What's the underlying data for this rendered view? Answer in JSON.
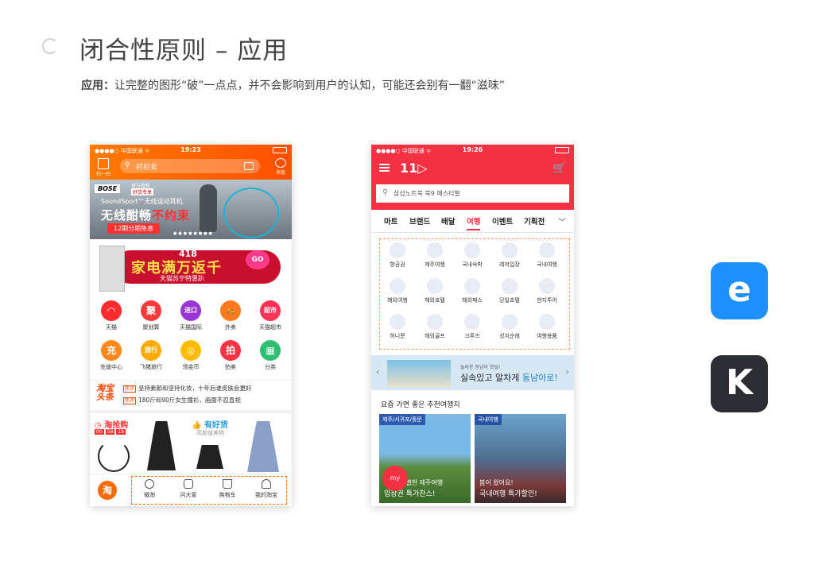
{
  "slide": {
    "title": "闭合性原则 – 应用",
    "subtitle_label": "应用：",
    "subtitle_text": "让完整的图形“破”一点点，并不会影响到用户的认知，可能还会别有一翻“滋味”"
  },
  "taobao": {
    "status": {
      "carrier": "●●●●○ 中国联通 ᯤ",
      "time": "19:23"
    },
    "scan_label": "扫一扫",
    "search_placeholder": "衬衫女",
    "message_label": "消息",
    "banner": {
      "brand": "BOSE",
      "tag1": "官方授权",
      "tag2": "好货专享",
      "subline": "SoundSport™无线运动耳机",
      "headline_a": "无线酣畅",
      "headline_b": "不约束",
      "button": "12期分期免息",
      "dots": "●●●●●●●●"
    },
    "promo": {
      "badge": "418",
      "headline": "家电满万返千",
      "sub": "天猫苏宁特惠趴",
      "go": "GO"
    },
    "icons_row1": [
      {
        "label": "天猫",
        "glyph": "◠",
        "color": "#ff2d2d"
      },
      {
        "label": "聚划算",
        "glyph": "聚",
        "color": "#ff3a3a"
      },
      {
        "label": "天猫国际",
        "glyph": "进口",
        "color": "#9b35d6"
      },
      {
        "label": "外卖",
        "glyph": "🛵",
        "color": "#ff7a1a"
      },
      {
        "label": "天猫超市",
        "glyph": "超市",
        "color": "#ff3355"
      }
    ],
    "icons_row2": [
      {
        "label": "充值中心",
        "glyph": "充",
        "color": "#ff8a1a"
      },
      {
        "label": "飞猪旅行",
        "glyph": "旅行",
        "color": "#ffaa00"
      },
      {
        "label": "领金币",
        "glyph": "◎",
        "color": "#ffbb00"
      },
      {
        "label": "拍卖",
        "glyph": "拍",
        "color": "#ff3344"
      },
      {
        "label": "分类",
        "glyph": "▦",
        "color": "#2fbf71"
      }
    ],
    "headlines": {
      "logo": "淘宝头条",
      "tag": "热评",
      "line1": "坚持素颜和坚持化妆，十年后谁皮肤会更好",
      "line2": "180斤和90斤女生撞衫，画面不忍直视"
    },
    "flash": {
      "title": "淘抢购",
      "time": [
        "00",
        "58",
        "19"
      ]
    },
    "haohuo": {
      "title": "有好货",
      "sub": "高颜值美物"
    },
    "tabbar": {
      "logo": "淘",
      "items": [
        "微淘",
        "问大家",
        "购物车",
        "我的淘宝"
      ]
    }
  },
  "st11": {
    "status": {
      "carrier": "●●●●○ 中国联通 ᯤ",
      "time": "19:26"
    },
    "logo": "11",
    "search_text": "삼성노트북 북9 페스티벌",
    "tabs": [
      "마트",
      "브랜드",
      "배달",
      "여행",
      "이벤트",
      "기획전"
    ],
    "active_tab": "여행",
    "grid": [
      "항공권",
      "제주여행",
      "국내숙박",
      "레저입장",
      "국내여행",
      "해외여행",
      "해외호텔",
      "해외패스",
      "당일호텔",
      "현지투어",
      "허니문",
      "해외골프",
      "크루즈",
      "성지순례",
      "여행용품"
    ],
    "banner": {
      "small": "놀라운 동남아 핫딜!",
      "big_a": "실속있고 알차게",
      "big_b": "동남아로!"
    },
    "recommend_title": "요즘 가면 좋은 추천여행지",
    "cards": [
      {
        "tag": "제주/서귀포/중문",
        "line1": "특별한 제주여행",
        "line2": "입장권 특가찬스!"
      },
      {
        "tag": "국내여행",
        "line1": "봄이 왔어요!",
        "line2": "국내여행 특가할인!"
      }
    ],
    "my_label": "my"
  },
  "apps": {
    "e_glyph": "e",
    "k_glyph": "K"
  }
}
